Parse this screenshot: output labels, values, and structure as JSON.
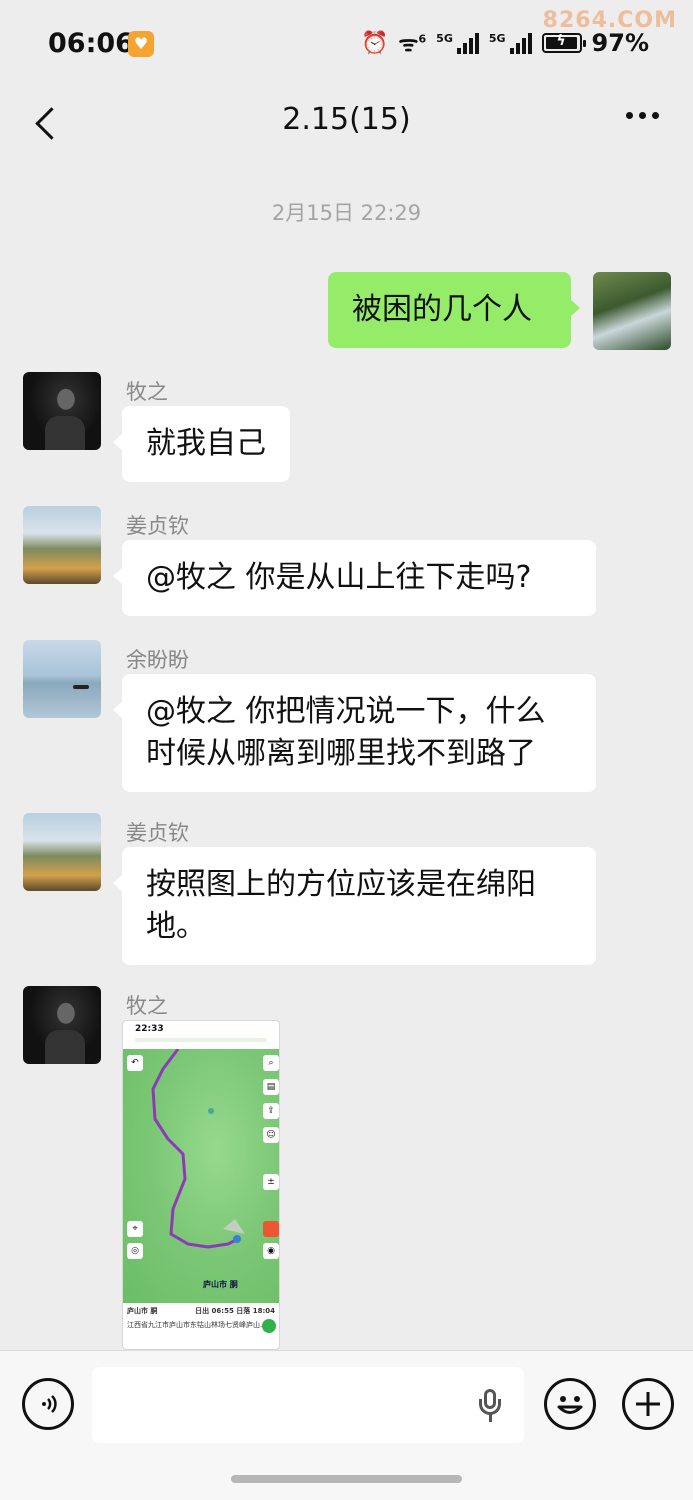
{
  "status_bar": {
    "time": "06:06",
    "battery": "97%",
    "battery_level": 0.97,
    "network_1": "5G",
    "network_2": "5G",
    "wifi_label": "6",
    "watermark": "8264.COM"
  },
  "header": {
    "title": "2.15(15)",
    "back_icon": "chevron-left-icon",
    "more_icon": "more-dots-icon"
  },
  "timestamp": "2月15日 22:29",
  "messages": [
    {
      "direction": "out",
      "text": "被困的几个人"
    },
    {
      "direction": "in",
      "sender": "牧之",
      "text": "就我自己"
    },
    {
      "direction": "in",
      "sender": "姜贞钦",
      "text": "@牧之  你是从山上往下走吗?"
    },
    {
      "direction": "in",
      "sender": "余盼盼",
      "lines": [
        "@牧之  你把情况说一下，什么",
        "时候从哪离到哪里找不到路了"
      ]
    },
    {
      "direction": "in",
      "sender": "姜贞钦",
      "lines": [
        "按照图上的方位应该是在绵阳",
        "地。"
      ]
    },
    {
      "direction": "in",
      "sender": "牧之",
      "type": "image",
      "image": {
        "time": "22:33",
        "location_title": "庐山市 胴",
        "sun_times": "日出 06:55  日落 18:04",
        "address": "江西省九江市庐山市东牯山林场七贤峰庐山…",
        "place_label": "庐山市 胴"
      }
    }
  ],
  "input_bar": {
    "voice_icon": "voice-icon",
    "mic_icon": "microphone-icon",
    "emoji_icon": "emoji-icon",
    "plus_icon": "plus-icon"
  },
  "colors": {
    "background": "#ededed",
    "outgoing_bubble": "#95ec69",
    "incoming_bubble": "#ffffff",
    "route": "#8e3ab8"
  }
}
